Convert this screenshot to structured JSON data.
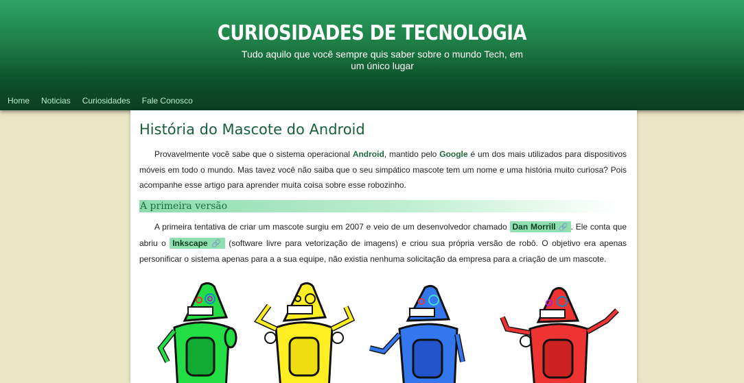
{
  "header": {
    "title": "CURIOSIDADES DE TECNOLOGIA",
    "tagline": "Tudo aquilo que você sempre quis saber sobre o mundo Tech, em um único lugar"
  },
  "nav": {
    "items": [
      "Home",
      "Noticias",
      "Curiosidades",
      "Fale Conosco"
    ]
  },
  "article": {
    "title": "História do Mascote do Android",
    "intro": {
      "t1": "Provavelmente você sabe que o sistema operacional ",
      "b1": "Android",
      "t2": ", mantido pelo ",
      "b2": "Google",
      "t3": " é um dos mais utilizados para dispositivos móveis em todo o mundo. Mas tavez você não saiba que o seu simpático mascote tem um nome e uma história muito curiosa? Pois acompanhe esse artigo para aprender muita coisa sobre esse robozinho."
    },
    "section_title": "A primeira versão",
    "section": {
      "t1": "A primeira tentativa de criar um mascote surgiu em 2007 e veio de um desenvolvedor chamado ",
      "tag1": "Dan Morrill",
      "t2": ". Ele conta que abriu o ",
      "tag2": "Inkscape",
      "t3": " (software livre para vetorização de imagens) e criou sua própria versão de robô. O objetivo era apenas personificar o sistema apenas para a a sua equipe, não existia nenhuma solicitação da empresa para a criação de um mascote."
    },
    "link_icon": "🔗"
  },
  "colors": {
    "robots": [
      "#22dd44",
      "#ffee22",
      "#3377ee",
      "#ee3333"
    ]
  }
}
